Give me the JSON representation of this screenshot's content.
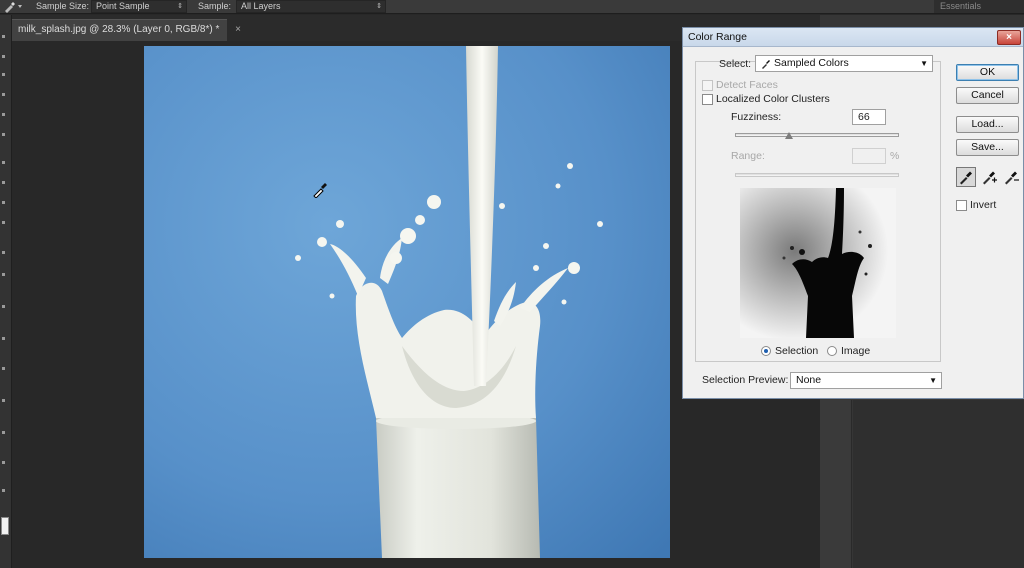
{
  "options_bar": {
    "sample_size_label": "Sample Size:",
    "sample_size_value": "Point Sample",
    "sample_label": "Sample:",
    "sample_value": "All Layers",
    "workspace": "Essentials"
  },
  "document": {
    "tab_title": "milk_splash.jpg @ 28.3% (Layer 0, RGB/8*) *",
    "tab_close": "×"
  },
  "dialog": {
    "title": "Color Range",
    "close": "×",
    "select_label": "Select:",
    "select_value": "Sampled Colors",
    "detect_faces": "Detect Faces",
    "localized_clusters": "Localized Color Clusters",
    "fuzziness_label": "Fuzziness:",
    "fuzziness_value": "66",
    "fuzziness_fraction": 0.33,
    "range_label": "Range:",
    "range_unit": "%",
    "selection_radio": "Selection",
    "image_radio": "Image",
    "preview_label": "Selection Preview:",
    "preview_value": "None",
    "ok": "OK",
    "cancel": "Cancel",
    "load": "Load...",
    "save": "Save...",
    "invert": "Invert"
  },
  "colors": {
    "background_blue": "#5b95cc",
    "dialog_bg": "#f0f0f0",
    "ps_dark": "#282828"
  }
}
